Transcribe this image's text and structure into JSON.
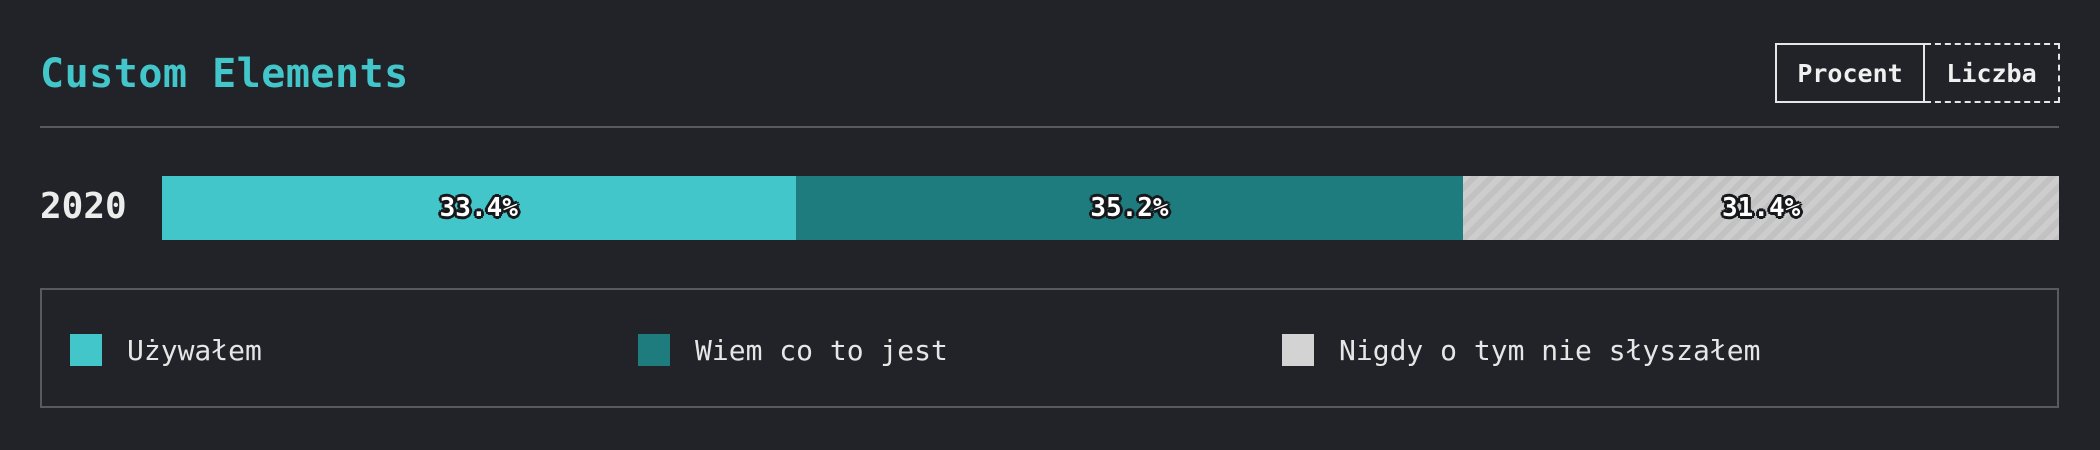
{
  "header": {
    "title": "Custom Elements",
    "unit_switch": {
      "options": [
        "Procent",
        "Liczba"
      ],
      "selected": "Procent"
    }
  },
  "chart_data": {
    "type": "bar",
    "orientation": "horizontal",
    "stacked": true,
    "normalized_to": 100,
    "categories": [
      "2020"
    ],
    "series": [
      {
        "name": "Używałem",
        "values": [
          33.4
        ],
        "labels": [
          "33.4%"
        ],
        "color": "#43c6c9",
        "pattern": "solid"
      },
      {
        "name": "Wiem co to jest",
        "values": [
          35.2
        ],
        "labels": [
          "35.2%"
        ],
        "color": "#1f7c7e",
        "pattern": "solid"
      },
      {
        "name": "Nigdy o tym nie słyszałem",
        "values": [
          31.4
        ],
        "labels": [
          "31.4%"
        ],
        "color": "#cfcfcf",
        "pattern": "diagonal-stripes"
      }
    ],
    "title": "Custom Elements",
    "legend_position": "bottom"
  }
}
